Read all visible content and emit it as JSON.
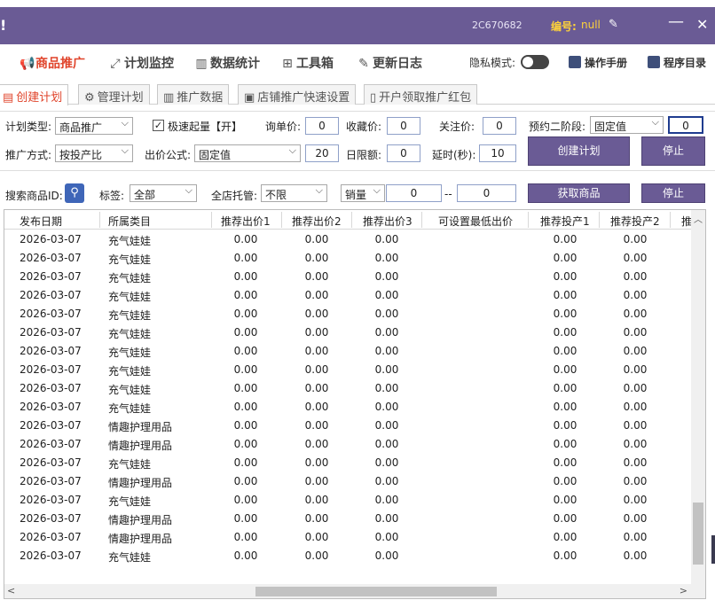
{
  "titlebar": {
    "left_mark": "!",
    "code": "2C670682",
    "id_label": "编号:",
    "id_value": "null",
    "minimize": "—",
    "close": "✕"
  },
  "nav": {
    "items": [
      {
        "label": "商品推广",
        "icon": "megaphone-icon",
        "active": true
      },
      {
        "label": "计划监控",
        "icon": "monitor-icon"
      },
      {
        "label": "数据统计",
        "icon": "bar-chart-icon"
      },
      {
        "label": "工具箱",
        "icon": "grid-icon"
      },
      {
        "label": "更新日志",
        "icon": "edit-icon"
      }
    ],
    "privacy_label": "隐私模式:",
    "manual": "操作手册",
    "program_catalog": "程序目录"
  },
  "tabs": [
    {
      "label": "创建计划",
      "active": true
    },
    {
      "label": "管理计划"
    },
    {
      "label": "推广数据"
    },
    {
      "label": "店铺推广快速设置"
    },
    {
      "label": "开户领取推广红包"
    }
  ],
  "form": {
    "plan_type_label": "计划类型:",
    "plan_type_value": "商品推广",
    "fast_label": "极速起量【开】",
    "inquiry_label": "询单价:",
    "inquiry_value": "0",
    "favorite_label": "收藏价:",
    "favorite_value": "0",
    "follow_label": "关注价:",
    "follow_value": "0",
    "stage2_label": "预约二阶段:",
    "stage2_value": "固定值",
    "stage2_input": "0",
    "promo_method_label": "推广方式:",
    "promo_method_value": "按投产比",
    "bid_formula_label": "出价公式:",
    "bid_formula_value": "固定值",
    "bid_value": "20",
    "daily_limit_label": "日限额:",
    "daily_limit_value": "0",
    "delay_label": "延时(秒):",
    "delay_value": "10",
    "create_button": "创建计划",
    "stop_button": "停止"
  },
  "search": {
    "id_label": "搜索商品ID:",
    "tag_label": "标签:",
    "tag_value": "全部",
    "store_label": "全店托管:",
    "store_value": "不限",
    "sales_value": "销量",
    "min_value": "0",
    "range_sep": "--",
    "max_value": "0",
    "fetch_button": "获取商品",
    "stop_button": "停止"
  },
  "table": {
    "columns": [
      "发布日期",
      "所属类目",
      "推荐出价1",
      "推荐出价2",
      "推荐出价3",
      "可设置最低出价",
      "推荐投产1",
      "推荐投产2",
      "推"
    ],
    "rows": [
      [
        "2026-03-07",
        "充气娃娃",
        "0.00",
        "0.00",
        "0.00",
        "",
        "0.00",
        "0.00"
      ],
      [
        "2026-03-07",
        "充气娃娃",
        "0.00",
        "0.00",
        "0.00",
        "",
        "0.00",
        "0.00"
      ],
      [
        "2026-03-07",
        "充气娃娃",
        "0.00",
        "0.00",
        "0.00",
        "",
        "0.00",
        "0.00"
      ],
      [
        "2026-03-07",
        "充气娃娃",
        "0.00",
        "0.00",
        "0.00",
        "",
        "0.00",
        "0.00"
      ],
      [
        "2026-03-07",
        "充气娃娃",
        "0.00",
        "0.00",
        "0.00",
        "",
        "0.00",
        "0.00"
      ],
      [
        "2026-03-07",
        "充气娃娃",
        "0.00",
        "0.00",
        "0.00",
        "",
        "0.00",
        "0.00"
      ],
      [
        "2026-03-07",
        "充气娃娃",
        "0.00",
        "0.00",
        "0.00",
        "",
        "0.00",
        "0.00"
      ],
      [
        "2026-03-07",
        "充气娃娃",
        "0.00",
        "0.00",
        "0.00",
        "",
        "0.00",
        "0.00"
      ],
      [
        "2026-03-07",
        "充气娃娃",
        "0.00",
        "0.00",
        "0.00",
        "",
        "0.00",
        "0.00"
      ],
      [
        "2026-03-07",
        "充气娃娃",
        "0.00",
        "0.00",
        "0.00",
        "",
        "0.00",
        "0.00"
      ],
      [
        "2026-03-07",
        "情趣护理用品",
        "0.00",
        "0.00",
        "0.00",
        "",
        "0.00",
        "0.00"
      ],
      [
        "2026-03-07",
        "情趣护理用品",
        "0.00",
        "0.00",
        "0.00",
        "",
        "0.00",
        "0.00"
      ],
      [
        "2026-03-07",
        "充气娃娃",
        "0.00",
        "0.00",
        "0.00",
        "",
        "0.00",
        "0.00"
      ],
      [
        "2026-03-07",
        "情趣护理用品",
        "0.00",
        "0.00",
        "0.00",
        "",
        "0.00",
        "0.00"
      ],
      [
        "2026-03-07",
        "充气娃娃",
        "0.00",
        "0.00",
        "0.00",
        "",
        "0.00",
        "0.00"
      ],
      [
        "2026-03-07",
        "情趣护理用品",
        "0.00",
        "0.00",
        "0.00",
        "",
        "0.00",
        "0.00"
      ],
      [
        "2026-03-07",
        "情趣护理用品",
        "0.00",
        "0.00",
        "0.00",
        "",
        "0.00",
        "0.00"
      ],
      [
        "2026-03-07",
        "充气娃娃",
        "0.00",
        "0.00",
        "0.00",
        "",
        "0.00",
        "0.00"
      ]
    ]
  },
  "colors": {
    "titlebar": "#6a5b95",
    "accent": "#e0442b",
    "id_highlight": "#ffd23a",
    "button": "#6a5b95"
  }
}
